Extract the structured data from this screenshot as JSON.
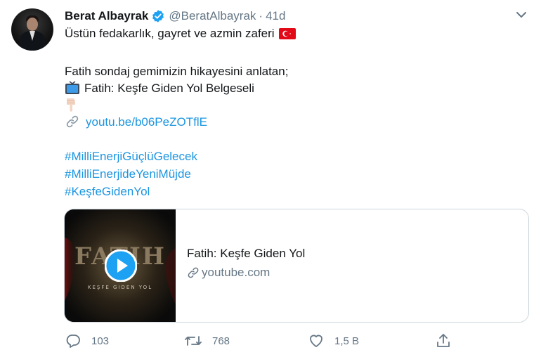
{
  "tweet": {
    "author_name": "Berat Albayrak",
    "author_handle": "@BeratAlbayrak",
    "separator": "·",
    "time": "41d",
    "line1": "Üstün fedakarlık, gayret ve azmin zaferi",
    "line2": "Fatih sondaj gemimizin hikayesini anlatan;",
    "line3": "Fatih: Keşfe Giden Yol Belgeseli",
    "link": "youtu.be/b06PeZOTflE",
    "hashtags": [
      "#MilliEnerjiGüçlüGelecek",
      "#MilliEnerjideYeniMüjde",
      "#KeşfeGidenYol"
    ]
  },
  "card": {
    "thumb_title": "FATIH",
    "thumb_subtitle": "KEŞFE GIDEN YOL",
    "title": "Fatih: Keşfe Giden Yol",
    "domain": "youtube.com"
  },
  "actions": {
    "replies": "103",
    "retweets": "768",
    "likes": "1,5 B"
  },
  "icons": [
    "verified-badge-icon",
    "chevron-down-icon",
    "turkey-flag-emoji",
    "television-emoji",
    "pointing-down-hand-emoji",
    "link-icon",
    "play-button-icon",
    "reply-icon",
    "retweet-icon",
    "like-icon",
    "share-icon"
  ],
  "colors": {
    "accent": "#1b95e0",
    "muted": "#657786",
    "text": "#14171a",
    "border": "#ccd6dd"
  }
}
